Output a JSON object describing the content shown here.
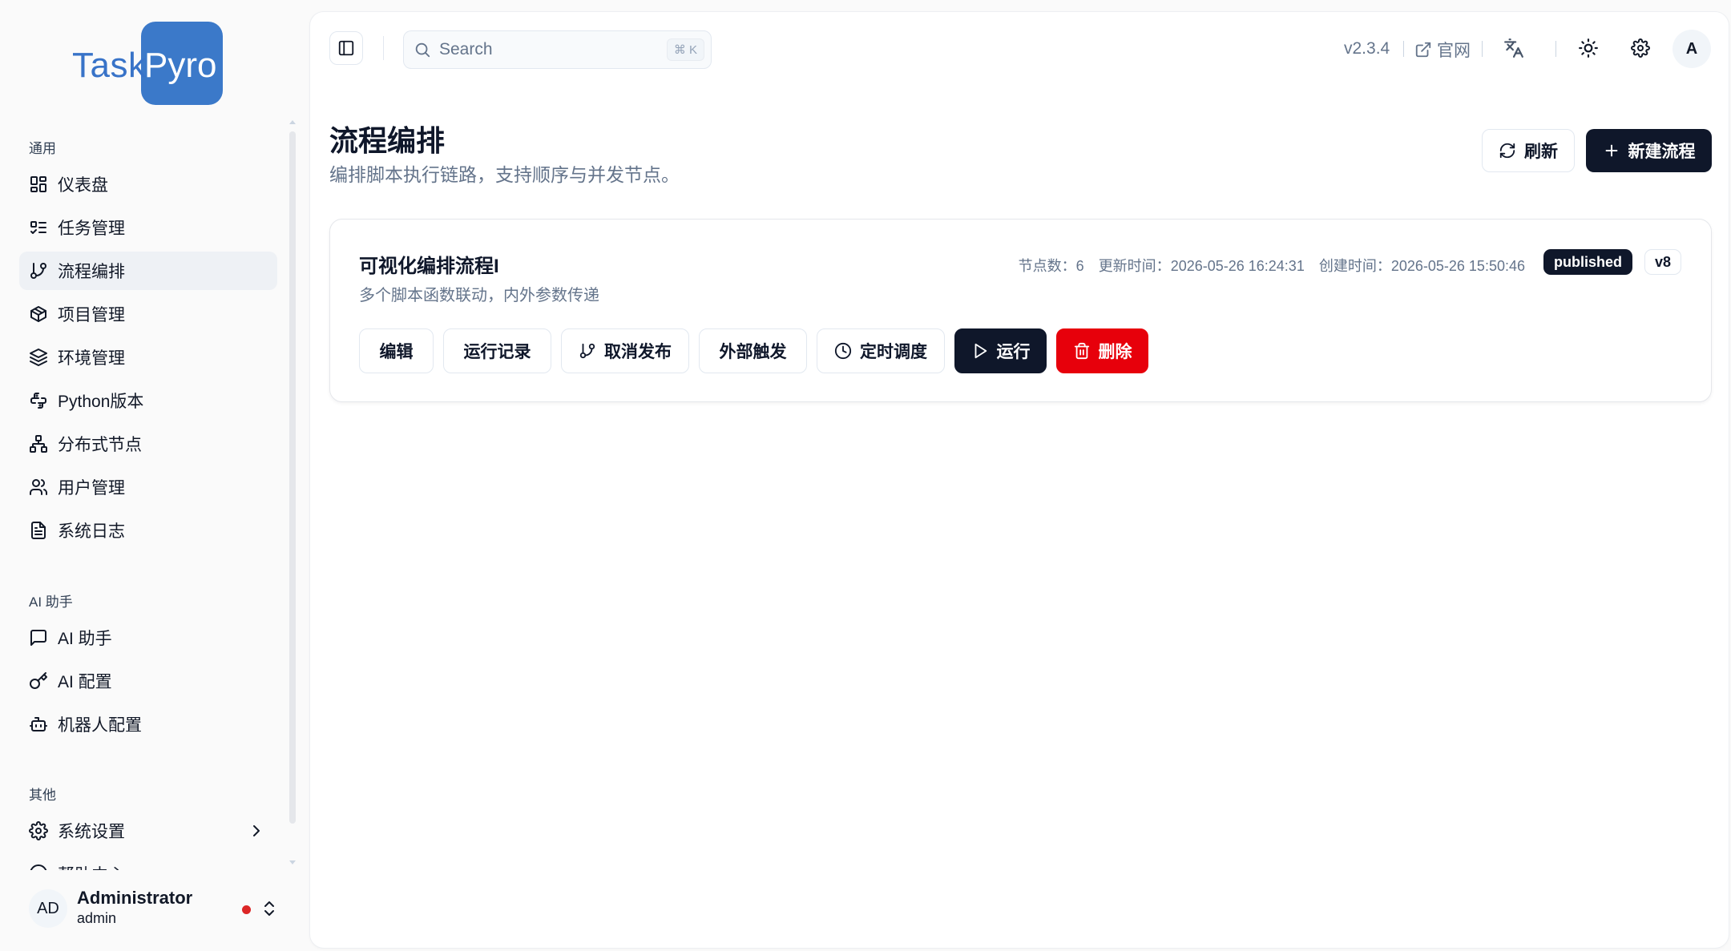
{
  "app": {
    "logo_left": "Task",
    "logo_right": "Pyro",
    "brand_color": "#3b79c9"
  },
  "sidebar": {
    "sections": [
      {
        "title": "通用",
        "items": [
          {
            "label": "仪表盘",
            "icon": "dashboard-icon"
          },
          {
            "label": "任务管理",
            "icon": "list-todo-icon"
          },
          {
            "label": "流程编排",
            "icon": "git-branch-icon",
            "active": true
          },
          {
            "label": "项目管理",
            "icon": "package-icon"
          },
          {
            "label": "环境管理",
            "icon": "layers-icon"
          },
          {
            "label": "Python版本",
            "icon": "python-icon"
          },
          {
            "label": "分布式节点",
            "icon": "network-icon"
          },
          {
            "label": "用户管理",
            "icon": "users-icon"
          },
          {
            "label": "系统日志",
            "icon": "file-text-icon"
          }
        ]
      },
      {
        "title": "AI 助手",
        "items": [
          {
            "label": "AI 助手",
            "icon": "message-square-icon"
          },
          {
            "label": "AI 配置",
            "icon": "key-icon"
          },
          {
            "label": "机器人配置",
            "icon": "bot-icon"
          }
        ]
      },
      {
        "title": "其他",
        "items": [
          {
            "label": "系统设置",
            "icon": "settings-icon",
            "has_submenu": true
          },
          {
            "label": "帮助中心",
            "icon": "help-circle-icon",
            "partially_hidden": true
          }
        ]
      }
    ],
    "user": {
      "initials": "AD",
      "name": "Administrator",
      "role": "admin",
      "status_color": "#dc2626"
    }
  },
  "topbar": {
    "search_placeholder": "Search",
    "search_shortcut": "⌘ K",
    "version": "v2.3.4",
    "official_site": "官网",
    "avatar_initial": "A"
  },
  "page": {
    "title": "流程编排",
    "description": "编排脚本执行链路，支持顺序与并发节点。",
    "refresh_label": "刷新",
    "new_flow_label": "新建流程"
  },
  "flows": [
    {
      "name": "可视化编排流程I",
      "description": "多个脚本函数联动，内外参数传递",
      "node_count_label": "节点数：",
      "node_count": "6",
      "updated_label": "更新时间：",
      "updated_at": "2026-05-26 16:24:31",
      "created_label": "创建时间：",
      "created_at": "2026-05-26 15:50:46",
      "status": "published",
      "version": "v8",
      "actions": {
        "edit": "编辑",
        "run_history": "运行记录",
        "unpublish": "取消发布",
        "external_trigger": "外部触发",
        "schedule": "定时调度",
        "run": "运行",
        "delete": "删除"
      }
    }
  ],
  "colors": {
    "primary_dark": "#0f172a",
    "danger": "#e7000b",
    "muted_text": "#64748b"
  }
}
